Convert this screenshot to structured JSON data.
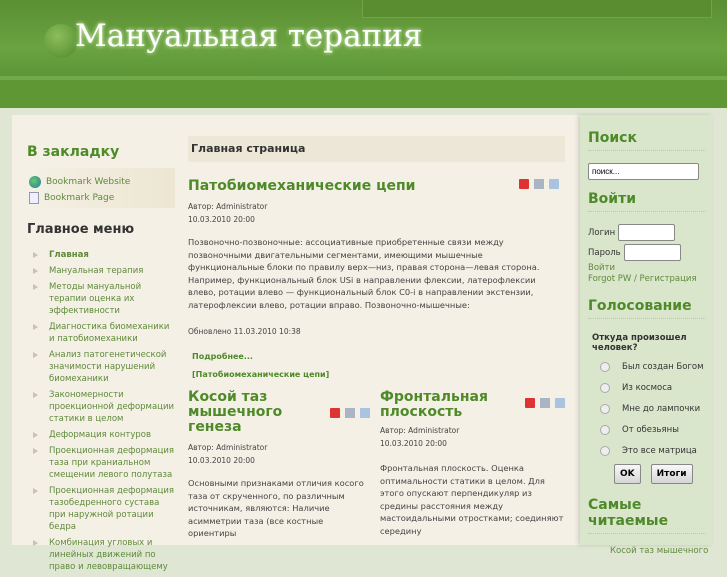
{
  "site": {
    "title": "Мануальная терапия"
  },
  "bookmark": {
    "title": "В закладку",
    "items": [
      {
        "label": "Bookmark Website",
        "icon": "globe-icon"
      },
      {
        "label": "Bookmark Page",
        "icon": "page-icon"
      }
    ]
  },
  "menu": {
    "title": "Главное меню",
    "items": [
      "Главная",
      "Мануальная терапия",
      "Методы мануальной терапии оценка их эффективности",
      "Диагностика биомеханики и патобиомеханики",
      "Анализ патогенетической значимости нарушений биомеханики",
      "Закономерности проекционной деформации статики в целом",
      "Деформация контуров",
      "Проекционная деформация таза при краниальном смещении левого полутаза",
      "Проекционная деформация тазобедренного сустава при наружной ротации бедра",
      "Комбинация угловых и линейных движений по право и левовращающему"
    ]
  },
  "main": {
    "heading": "Главная страница",
    "articles": [
      {
        "title": "Патобиомеханические цепи",
        "author": "Автор: Administrator",
        "date": "10.03.2010 20:00",
        "text": "Позвоночно-позвоночные: ассоциативные   приобретенные связи между позвоночными двигательными сегментами, имеющими мышечные функциональные блоки по правилу верх—низ, правая сторона—левая сторона. Например, функциональный блок USi в направлении флексии, латерофлексии влево, ротации влево — функциональный блок C0-i в направлении экстензии, латерофлексии влево, ротации вправо. Позвоночно-мышечные:",
        "updated": "Обновлено 11.03.2010 10:38",
        "more": "Подробнее... [Патобиомеханические цепи]"
      },
      {
        "title": "Косой таз мышечного генеза",
        "author": "Автор: Administrator",
        "date": "10.03.2010 20:00",
        "text": "Основными признаками отличия косого таза от скрученного, по различным источникам, являются:   Наличие асимметрии таза (все костные ориентиры"
      },
      {
        "title": "Фронтальная плоскость",
        "author": "Автор: Administrator",
        "date": "10.03.2010 20:00",
        "text": "Фронтальная плоскость. Оценка оптимальности статики в целом. Для этого опускают перпендикуляр из средины расстояния между мастоидальными отростками; соединяют середину"
      }
    ]
  },
  "search": {
    "title": "Поиск",
    "value": "поиск..."
  },
  "login": {
    "title": "Войти",
    "login_label": "Логин",
    "password_label": "Пароль",
    "submit": "Войти",
    "links": "Forgot PW / Регистрация"
  },
  "poll": {
    "title": "Голосование",
    "question": "Откуда произошел человек?",
    "options": [
      "Был создан Богом",
      "Из космоса",
      "Мне до лампочки",
      "От обезьяны",
      "Это все матрица"
    ],
    "ok": "OK",
    "results": "Итоги"
  },
  "popular": {
    "title": "Самые читаемые",
    "items": [
      "Косой таз мышечного"
    ]
  }
}
